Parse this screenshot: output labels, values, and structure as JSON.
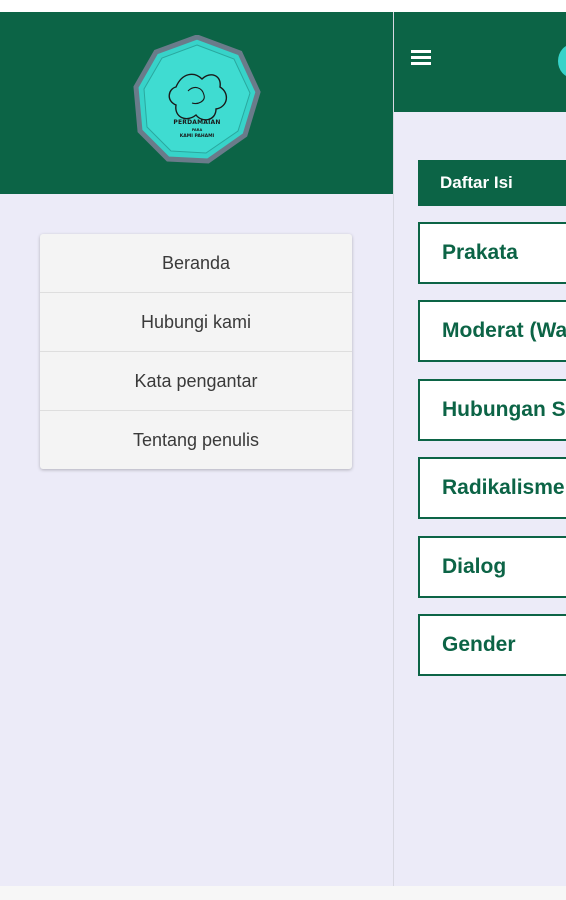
{
  "logo": {
    "line1": "PERDAMAIAN",
    "line2": "PARA",
    "line3": "KAMI PAHAMI"
  },
  "drawer": {
    "items": [
      {
        "label": "Beranda"
      },
      {
        "label": "Hubungi kami"
      },
      {
        "label": "Kata pengantar"
      },
      {
        "label": "Tentang penulis"
      }
    ]
  },
  "main": {
    "toc_title": "Daftar Isi",
    "toc": [
      {
        "label": "Prakata"
      },
      {
        "label": "Moderat (Wa"
      },
      {
        "label": "Hubungan S"
      },
      {
        "label": "Radikalisme"
      },
      {
        "label": "Dialog"
      },
      {
        "label": "Gender"
      }
    ]
  },
  "colors": {
    "primary": "#0c6446",
    "background": "#ecebf8",
    "logo": "#37d3c9"
  }
}
